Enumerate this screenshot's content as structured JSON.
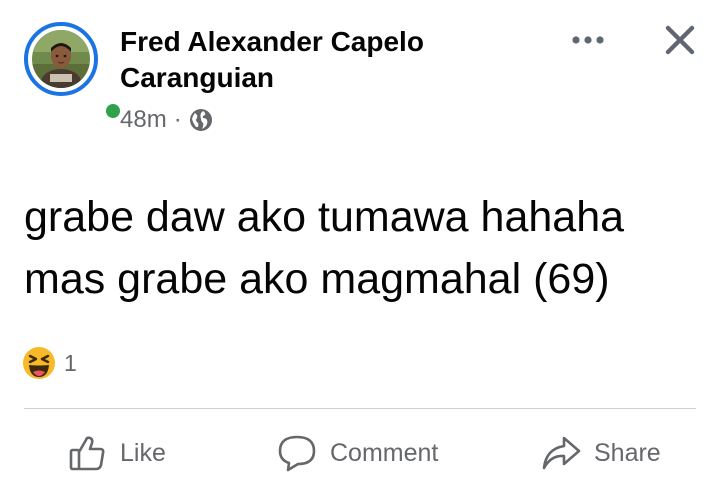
{
  "post": {
    "author": "Fred Alexander Capelo Caranguian",
    "time": "48m",
    "separator": "·",
    "audience_icon": "globe-icon",
    "text": "grabe daw ako tumawa hahaha\nmas grabe ako magmahal (69)",
    "reactions": {
      "icon": "laughing-emoji-icon",
      "count": "1"
    }
  },
  "header": {
    "more_icon": "more-options-icon",
    "close_icon": "close-icon"
  },
  "actions": {
    "like": "Like",
    "comment": "Comment",
    "share": "Share"
  },
  "colors": {
    "story_ring": "#1b74e4",
    "online": "#31a24c",
    "secondary_text": "#65676b",
    "divider": "#ced0d4",
    "reaction_yellow": "#f7b928"
  }
}
